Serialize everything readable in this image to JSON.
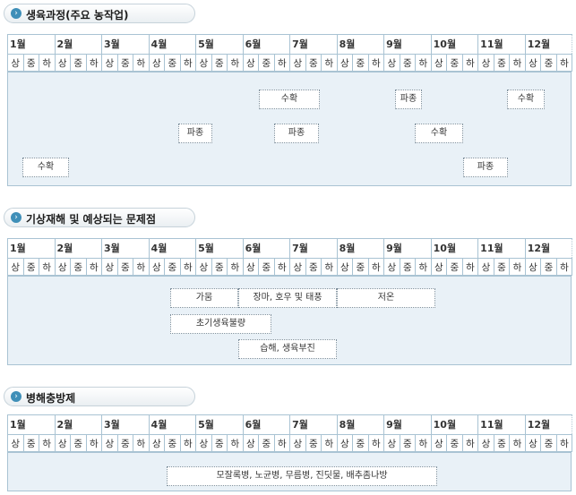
{
  "months": [
    "1월",
    "2월",
    "3월",
    "4월",
    "5월",
    "6월",
    "7월",
    "8월",
    "9월",
    "10월",
    "11월",
    "12월"
  ],
  "subdivisions": [
    "상",
    "중",
    "하"
  ],
  "sections": [
    {
      "title": "생육과정(주요 농작업)",
      "bars": [
        {
          "label": "수확"
        },
        {
          "label": "파종"
        },
        {
          "label": "수확"
        },
        {
          "label": "파종"
        },
        {
          "label": "파종"
        },
        {
          "label": "수확"
        },
        {
          "label": "수확"
        },
        {
          "label": "파종"
        }
      ]
    },
    {
      "title": "기상재해 및 예상되는 문제점",
      "bars": [
        {
          "label": "가뭄"
        },
        {
          "label": "장마, 호우 및 태풍"
        },
        {
          "label": "저온"
        },
        {
          "label": "초기생육불량"
        },
        {
          "label": "습해, 생육부진"
        }
      ]
    },
    {
      "title": "병해충방제",
      "bars": [
        {
          "label": "모잘록병, 노균병, 무름병, 진딧물, 배추좀나방"
        }
      ]
    }
  ],
  "colors": {
    "accent": "#3f8fb8",
    "gridline": "#a9c3d3",
    "area_bg": "#e9f1f7"
  }
}
